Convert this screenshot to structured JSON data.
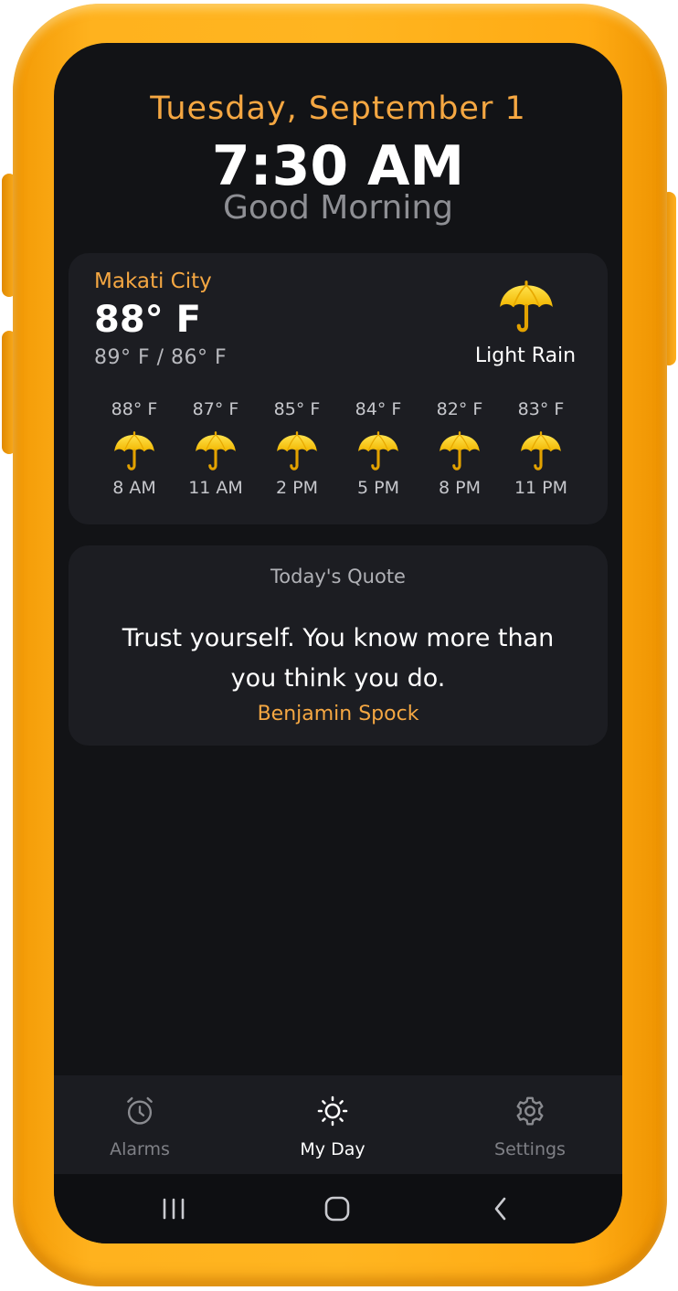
{
  "header": {
    "date": "Tuesday, September 1",
    "time": "7:30 AM",
    "greeting": "Good Morning"
  },
  "weather": {
    "city": "Makati City",
    "temperature": "88° F",
    "range": "89° F / 86° F",
    "condition": "Light Rain",
    "condition_icon": "umbrella-icon",
    "hourly": [
      {
        "temp": "88° F",
        "time": "8 AM",
        "icon": "umbrella-icon"
      },
      {
        "temp": "87° F",
        "time": "11 AM",
        "icon": "umbrella-icon"
      },
      {
        "temp": "85° F",
        "time": "2 PM",
        "icon": "umbrella-icon"
      },
      {
        "temp": "84° F",
        "time": "5 PM",
        "icon": "umbrella-icon"
      },
      {
        "temp": "82° F",
        "time": "8 PM",
        "icon": "umbrella-icon"
      },
      {
        "temp": "83° F",
        "time": "11 PM",
        "icon": "umbrella-icon"
      }
    ]
  },
  "quote": {
    "title": "Today's Quote",
    "text": "Trust yourself. You know more than you think you do.",
    "author": "Benjamin Spock"
  },
  "tabs": [
    {
      "label": "Alarms",
      "icon": "alarm-clock-icon",
      "active": false
    },
    {
      "label": "My Day",
      "icon": "sun-icon",
      "active": true
    },
    {
      "label": "Settings",
      "icon": "gear-icon",
      "active": false
    }
  ],
  "system_nav": {
    "icons": [
      "recent-apps-icon",
      "home-icon",
      "back-icon"
    ]
  },
  "colors": {
    "accent": "#f5a742",
    "background": "#121316",
    "card": "#1c1d22",
    "case": "#ffb21e"
  }
}
